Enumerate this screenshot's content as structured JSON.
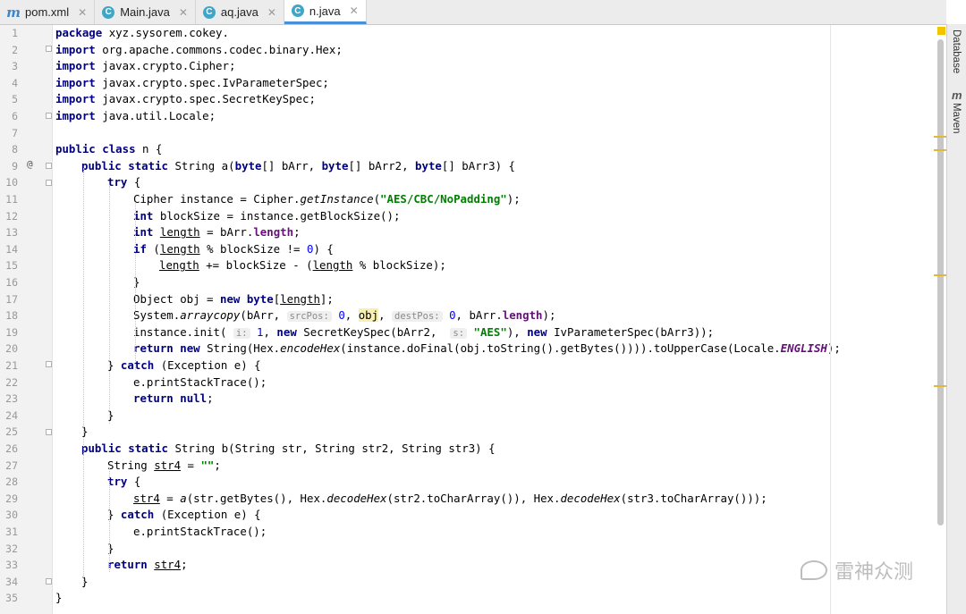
{
  "tabs": [
    {
      "label": "pom.xml",
      "icon": "maven-icon",
      "active": false
    },
    {
      "label": "Main.java",
      "icon": "java-class-icon",
      "active": false
    },
    {
      "label": "aq.java",
      "icon": "java-class-icon",
      "active": false
    },
    {
      "label": "n.java",
      "icon": "java-class-icon",
      "active": true
    }
  ],
  "sidebar": {
    "database": "Database",
    "maven": "Maven"
  },
  "watermark": "雷神众测",
  "line_numbers": [
    "1",
    "2",
    "3",
    "4",
    "5",
    "6",
    "7",
    "8",
    "9",
    "10",
    "11",
    "12",
    "13",
    "14",
    "15",
    "16",
    "17",
    "18",
    "19",
    "20",
    "21",
    "22",
    "23",
    "24",
    "25",
    "26",
    "27",
    "28",
    "29",
    "30",
    "31",
    "32",
    "33",
    "34",
    "35"
  ],
  "gutter_marker": "@",
  "hints": {
    "srcPos": "srcPos:",
    "destPos": "destPos:",
    "i": "i:",
    "s": "s:"
  },
  "code": {
    "l1": "package xyz.sysorem.cokey.",
    "l2": "import org.apache.commons.codec.binary.Hex;",
    "l3": "import javax.crypto.Cipher;",
    "l4": "import javax.crypto.spec.IvParameterSpec;",
    "l5": "import javax.crypto.spec.SecretKeySpec;",
    "l6": "import java.util.Locale;",
    "l8": "public class n {",
    "l9": "    public static String a(byte[] bArr, byte[] bArr2, byte[] bArr3) {",
    "l10": "        try {",
    "l11": "            Cipher instance = Cipher.getInstance(\"AES/CBC/NoPadding\");",
    "l12": "            int blockSize = instance.getBlockSize();",
    "l13": "            int length = bArr.length;",
    "l14": "            if (length % blockSize != 0) {",
    "l15": "                length += blockSize - (length % blockSize);",
    "l16": "            }",
    "l17": "            Object obj = new byte[length];",
    "l18": "            System.arraycopy(bArr, srcPos: 0, obj, destPos: 0, bArr.length);",
    "l19": "            instance.init( i: 1, new SecretKeySpec(bArr2,  s: \"AES\"), new IvParameterSpec(bArr3));",
    "l20": "            return new String(Hex.encodeHex(instance.doFinal(obj.toString().getBytes()))).toUpperCase(Locale.ENGLISH);",
    "l21": "        } catch (Exception e) {",
    "l22": "            e.printStackTrace();",
    "l23": "            return null;",
    "l24": "        }",
    "l25": "    }",
    "l26": "    public static String b(String str, String str2, String str3) {",
    "l27": "        String str4 = \"\";",
    "l28": "        try {",
    "l29": "            str4 = a(str.getBytes(), Hex.decodeHex(str2.toCharArray()), Hex.decodeHex(str3.toCharArray()));",
    "l30": "        } catch (Exception e) {",
    "l31": "            e.printStackTrace();",
    "l32": "        }",
    "l33": "        return str4;",
    "l34": "    }",
    "l35": "}"
  },
  "tokens": {
    "package": "package",
    "import": "import",
    "public": "public",
    "class": "class",
    "static": "static",
    "byte": "byte",
    "try": "try",
    "int": "int",
    "if": "if",
    "new": "new",
    "return": "return",
    "catch": "catch",
    "null": "null",
    "pkg_name": "xyz.sysorem.cokey.",
    "imp2": "org.apache.commons.codec.binary.Hex;",
    "imp3": "javax.crypto.Cipher;",
    "imp4": "javax.crypto.spec.IvParameterSpec;",
    "imp5": "javax.crypto.spec.SecretKeySpec;",
    "imp6": "java.util.Locale;",
    "cls_rest": "n {",
    "a_sig1": "String a(",
    "a_sig2": "[] bArr, ",
    "a_sig3": "[] bArr2, ",
    "a_sig4": "[] bArr3) {",
    "open_brace": " {",
    "l11a": "Cipher instance = Cipher.",
    "getInstance": "getInstance",
    "paren_open": "(",
    "aes_mode": "\"AES/CBC/NoPadding\"",
    "close_semi": ");",
    "l12b": "blockSize = instance.getBlockSize();",
    "length": "length",
    "l13b": " = bArr.",
    "semi": ";",
    "l14b": " % blockSize != ",
    "zero": "0",
    "one": "1",
    "l14c": ") {",
    "l15b": " += blockSize - (",
    "l15c": " % blockSize);",
    "close_brace": "}",
    "l17a": "Object obj = ",
    "l17c": "[",
    "l17d": "];",
    "l18a": "System.",
    "arraycopy": "arraycopy",
    "l18b": "(bArr, ",
    "comma_sp": ", ",
    "obj": "obj",
    "l18c": ", bArr.",
    "l19a": "instance.init( ",
    "l19b": ", ",
    "l19c": " SecretKeySpec(bArr2,  ",
    "aes": "\"AES\"",
    "l19d": "), ",
    "l19e": " IvParameterSpec(bArr3));",
    "l20a": " String(Hex.",
    "encodeHex": "encodeHex",
    "l20b": "(instance.doFinal(obj.toString().getBytes()))).toUpperCase(Locale.",
    "ENGLISH": "ENGLISH",
    "l20c": ");",
    "catch_close": "} ",
    "l21b": " (Exception e) {",
    "printst": "e.printStackTrace();",
    "b_sig": "String b(String str, String str2, String str3) {",
    "l27a": "String ",
    "str4": "str4",
    "l27b": " = ",
    "empty_str": "\"\"",
    "l29a": " = ",
    "a_call": "a",
    "l29b": "(str.getBytes(), Hex.",
    "decodeHex": "decodeHex",
    "l29c": "(str2.toCharArray()), Hex.",
    "l29d": "(str3.toCharArray()));",
    "sp": " "
  }
}
